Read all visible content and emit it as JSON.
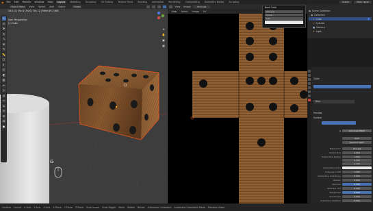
{
  "topbar": {
    "menus": [
      "File",
      "Edit",
      "Render",
      "Window",
      "Help"
    ],
    "tabs": [
      "Layout",
      "Modeling",
      "Sculpting",
      "UV Editing",
      "Texture Paint",
      "Shading",
      "Animation",
      "Rendering",
      "Compositing",
      "Geometry Nodes",
      "Scripting"
    ],
    "active_tab": "Layout",
    "scene": "Scene",
    "view_layer": "View Layer"
  },
  "viewport": {
    "mode": "Object Mode",
    "menus": [
      "View",
      "Select",
      "Add",
      "Object"
    ],
    "orientation": "Global",
    "overlay_line1": "User Perspective",
    "overlay_line2": "(1) Cube",
    "stats": "Ob 1/1 | Vtx 8 | Fa 6 | Tris 12 | Mem 69.1 MiB",
    "key_hint": "G"
  },
  "uv_editor": {
    "menus": [
      "View",
      "Image"
    ],
    "image_name": "dice.jpg",
    "header2_items": [
      "View",
      "Select",
      "Image",
      "UV"
    ]
  },
  "popup": {
    "title": "Base Color",
    "field1": "dice.jpg",
    "field2": "Linear",
    "field3": "Flat"
  },
  "outliner": {
    "title": "Scene Collection",
    "items": [
      {
        "label": "Scene Collection",
        "selected": false
      },
      {
        "label": "Collection",
        "selected": false
      },
      {
        "label": "Cube",
        "selected": true
      },
      {
        "label": "Cylinder",
        "selected": false
      },
      {
        "label": "Camera",
        "selected": false
      },
      {
        "label": "Light",
        "selected": false
      }
    ]
  },
  "properties": {
    "object_name": "Cube",
    "material_name": "Dice",
    "buttons": [
      "Preview",
      "Surface"
    ],
    "surface": "Principled BSDF",
    "rows": [
      {
        "label": "GGX",
        "value": ""
      },
      {
        "label": "Random Walk",
        "value": ""
      },
      {
        "label": "Base Color",
        "value": "dice.jpg"
      },
      {
        "label": "Subsurface",
        "value": "0.000"
      },
      {
        "label": "Subsurface Radius",
        "value": "1.000"
      },
      {
        "label": "",
        "value": "0.200"
      },
      {
        "label": "",
        "value": "0.100"
      },
      {
        "label": "Subsurface Color",
        "value": ""
      },
      {
        "label": "Subsurface IOR",
        "value": "1.400"
      },
      {
        "label": "Subsurface Anisotropy",
        "value": "0.000"
      },
      {
        "label": "Metallic",
        "value": "0.000"
      },
      {
        "label": "Specular",
        "value": "0.500"
      },
      {
        "label": "Specular Tint",
        "value": "0.000"
      },
      {
        "label": "Roughness",
        "value": "0.500"
      },
      {
        "label": "Anisotropic",
        "value": "0.000"
      },
      {
        "label": "Anisotropic Rotation",
        "value": "0.000"
      }
    ]
  },
  "statusbar": {
    "items": [
      "Confirm",
      "Cancel",
      "X Axis",
      "Y Axis",
      "Z Axis",
      "X Plane",
      "Y Plane",
      "Z Plane",
      "Snap Invert",
      "Snap Toggle",
      "Move",
      "Rotate",
      "Resize",
      "Automatic Constraint",
      "Automatic Constraint Plane",
      "Precision Mode"
    ]
  },
  "colors": {
    "accent": "#4772b3",
    "wood": "#8b5a2b",
    "selection_outline": "#e2551f"
  }
}
